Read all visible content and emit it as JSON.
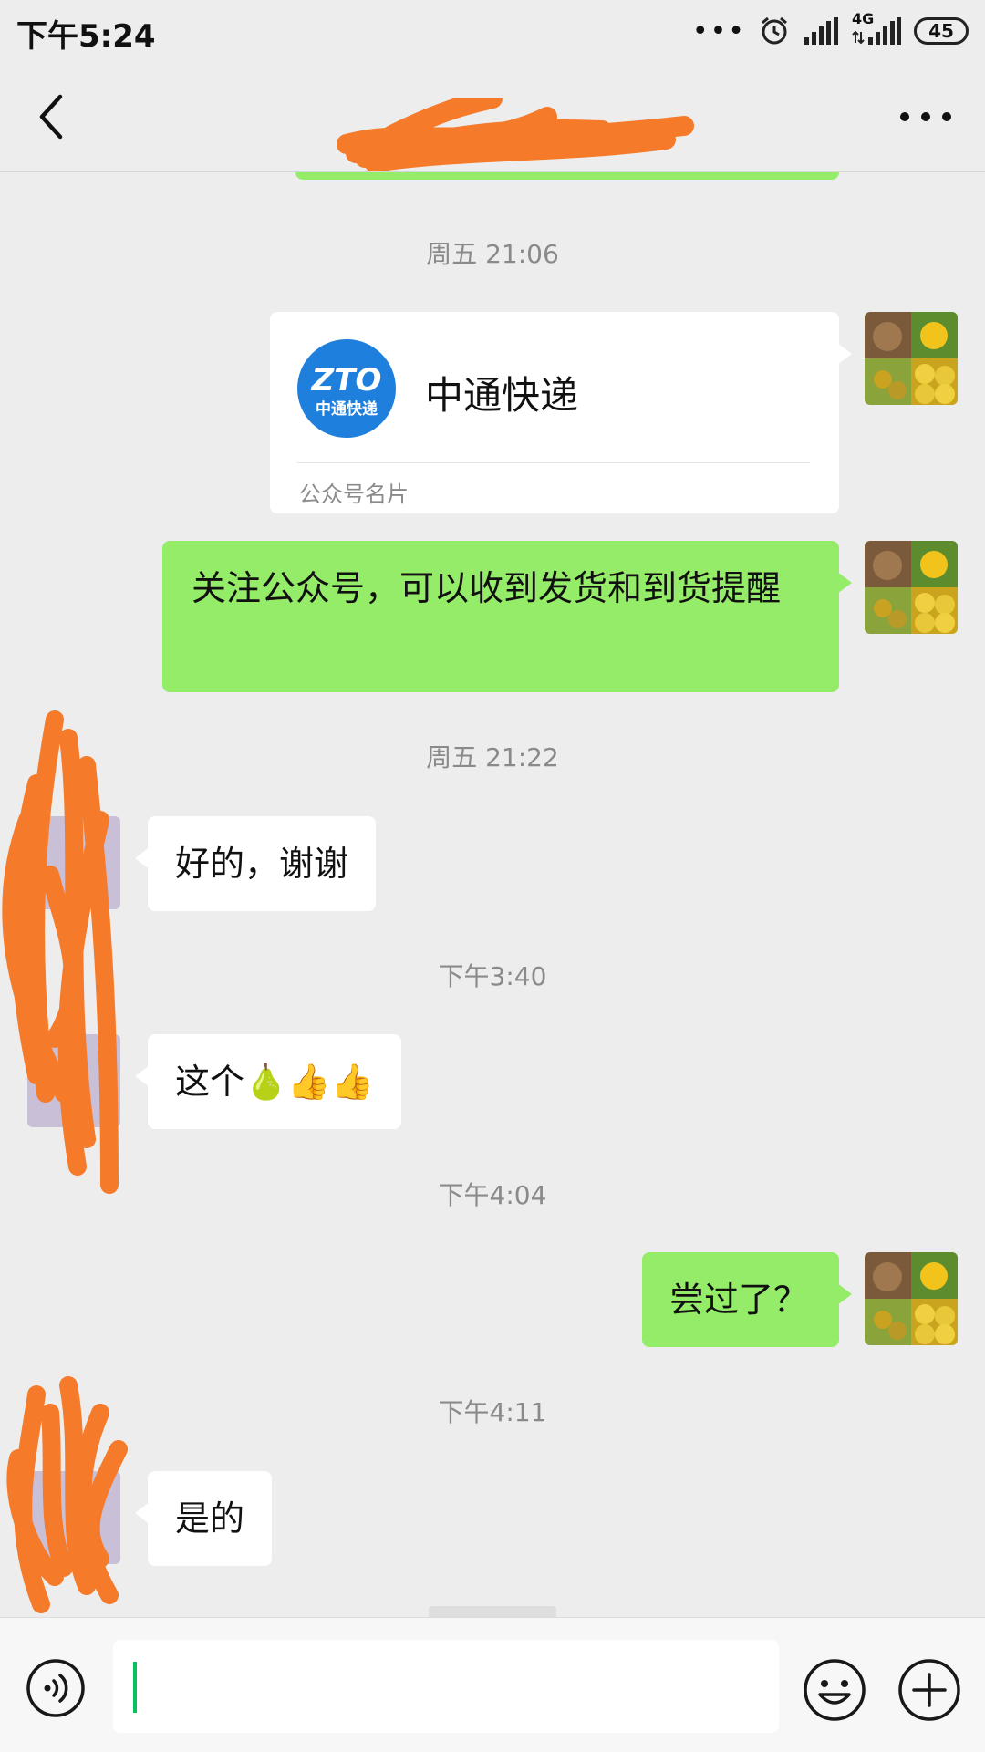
{
  "status_bar": {
    "time": "下午5:24",
    "network": "4G",
    "battery": "45"
  },
  "header": {
    "title": "",
    "back_icon": "chevron-left-icon",
    "more_icon": "more-horizontal-icon"
  },
  "messages": [
    {
      "type": "timestamp",
      "text": "周五 21:06"
    },
    {
      "type": "card",
      "side": "right",
      "name": "中通快递",
      "logo_text": "ZTO",
      "logo_sub": "中通快递",
      "card_type": "公众号名片"
    },
    {
      "type": "text",
      "side": "right",
      "text": "关注公众号，可以收到发货和到货提醒"
    },
    {
      "type": "timestamp",
      "text": "周五 21:22"
    },
    {
      "type": "text",
      "side": "left",
      "text": "好的，谢谢"
    },
    {
      "type": "timestamp",
      "text": "下午3:40"
    },
    {
      "type": "text",
      "side": "left",
      "text": "这个🍐👍👍"
    },
    {
      "type": "timestamp",
      "text": "下午4:04"
    },
    {
      "type": "text",
      "side": "right",
      "text": "尝过了？"
    },
    {
      "type": "timestamp",
      "text": "下午4:11"
    },
    {
      "type": "text",
      "side": "left",
      "text": "是的"
    }
  ],
  "input_bar": {
    "value": "",
    "voice_icon": "voice-icon",
    "emoji_icon": "emoji-icon",
    "plus_icon": "plus-circle-icon"
  },
  "colors": {
    "background": "#ededed",
    "sent_bubble": "#95ec69",
    "received_bubble": "#ffffff",
    "scribble": "#f57a2a",
    "cursor": "#07c160"
  }
}
